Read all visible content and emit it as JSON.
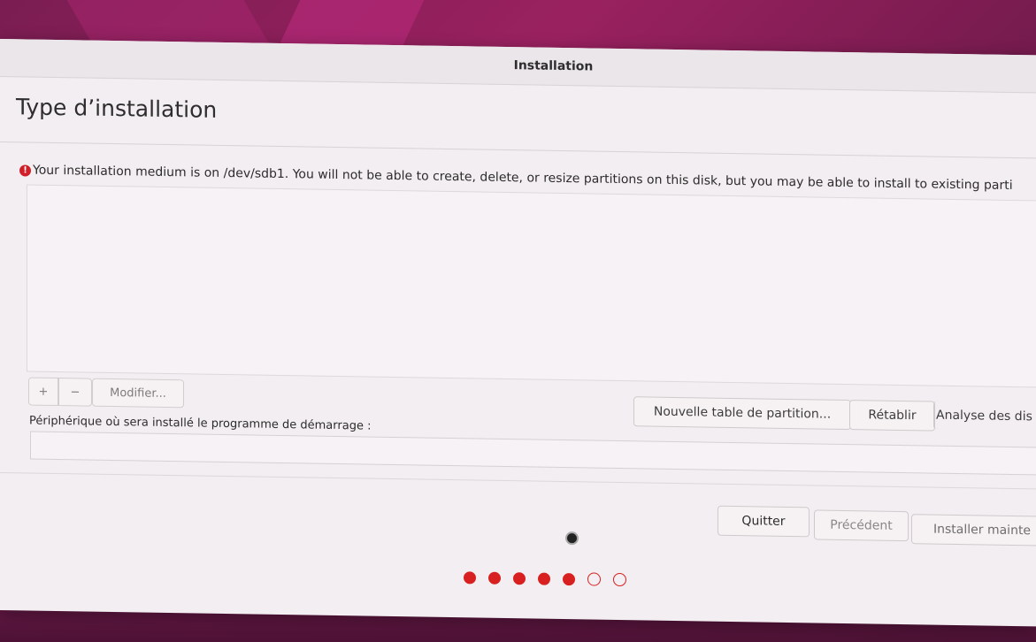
{
  "window": {
    "title": "Installation"
  },
  "page": {
    "title": "Type d’installation",
    "warning_text": "Your installation medium is on /dev/sdb1. You will not be able to create, delete, or resize partitions on this disk, but you may be able to install to existing parti"
  },
  "partition_toolbar": {
    "add_label": "+",
    "remove_label": "−",
    "modify_label": "Modifier...",
    "new_table_label": "Nouvelle table de partition...",
    "revert_label": "Rétablir",
    "analyse_label": "Analyse des dis"
  },
  "bootloader": {
    "label": "Périphérique où sera installé le programme de démarrage :",
    "value": ""
  },
  "footer": {
    "quit_label": "Quitter",
    "back_label": "Précédent",
    "install_label": "Installer mainte"
  },
  "progress": {
    "completed_steps": 5,
    "total_steps": 7,
    "accent_color": "#d7201f"
  }
}
